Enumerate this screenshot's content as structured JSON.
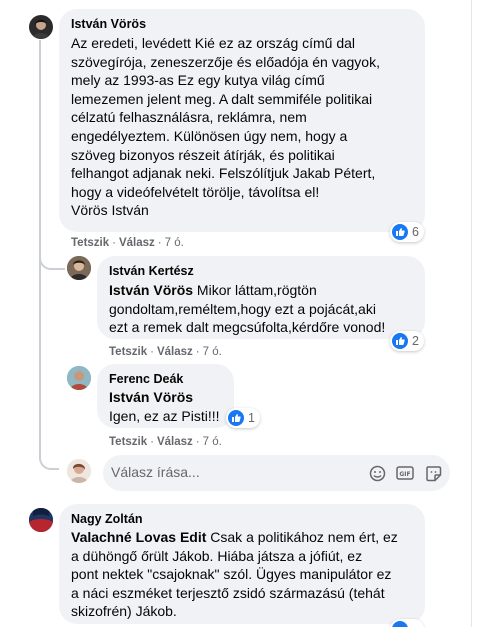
{
  "comments": [
    {
      "author": "István Vörös",
      "text": "Az eredeti, levédett Kié ez az ország című dal szövegírója, zeneszerzője és előadója én vagyok, mely az 1993-as Ez egy kutya világ című lemezemen jelent meg. A dalt semmiféle politikai célzatú felhasználásra, reklámra, nem engedélyeztem. Különösen úgy nem, hogy a szöveg bizonyos részeit átírják, és politikai felhangot adjanak neki. Felszólítjuk Jakab Pétert, hogy a videófelvételt törölje, távolítsa el! Vörös István",
      "lines": [
        "Az eredeti, levédett Kié ez az ország című dal",
        "szövegírója, zeneszerzője és előadója én vagyok,",
        "mely az 1993-as Ez egy kutya világ című",
        "lemezemen jelent meg. A dalt semmiféle politikai",
        "célzatú felhasználásra, reklámra, nem",
        "engedélyeztem. Különösen úgy nem, hogy a",
        "szöveg bizonyos részeit átírják, és politikai",
        "felhangot adjanak neki. Felszólítjuk Jakab Pétert,",
        "hogy a videófelvételt törölje, távolítsa el!",
        "Vörös István"
      ],
      "like_label": "Tetszik",
      "reply_label": "Válasz",
      "time": "7 ó.",
      "reactions": "6"
    },
    {
      "author": "István Kertész",
      "mention": "István Vörös",
      "lines": [
        " Mikor láttam,rögtön",
        "gondoltam,reméltem,hogy ezt a pojácát,aki",
        "ezt a remek dalt megcsúfolta,kérdőre vonod!"
      ],
      "like_label": "Tetszik",
      "reply_label": "Válasz",
      "time": "7 ó.",
      "reactions": "2"
    },
    {
      "author": "Ferenc Deák",
      "mention": "István Vörös",
      "lines": [
        "Igen, ez az Pisti!!!"
      ],
      "like_label": "Tetszik",
      "reply_label": "Válasz",
      "time": "7 ó.",
      "reactions": "1"
    },
    {
      "author": "Nagy Zoltán",
      "mention": "Valachné Lovas Edit",
      "lines": [
        " Csak a politikához nem ért, ez",
        "a dühöngő őrült Jákob. Hiába játsza a jófiút, ez",
        "pont nektek \"csajoknak\" szól. Ügyes manipulátor ez",
        "a náci eszméket terjesztő zsidó származású (tehát",
        "skizofrén) Jákob."
      ]
    }
  ],
  "reply_box": {
    "placeholder": "Válasz írása..."
  },
  "icons": {
    "like": "like-icon",
    "emoji": "emoji-icon",
    "gif": "gif-icon",
    "sticker": "sticker-icon"
  },
  "colors": {
    "bubble": "#f0f2f5",
    "like_blue": "#1877f2",
    "meta": "#65676b"
  }
}
